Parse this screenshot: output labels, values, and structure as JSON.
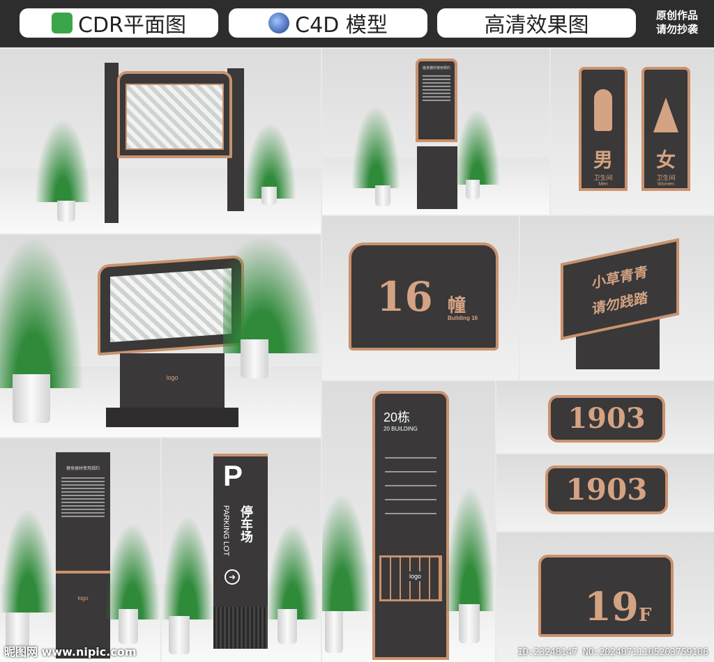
{
  "header": {
    "pill1": "CDR平面图",
    "pill2": "C4D 模型",
    "pill3": "高清效果图",
    "note_line1": "原创作品",
    "note_line2": "请勿抄袭"
  },
  "signs": {
    "male_char": "男",
    "male_sub": "卫生间",
    "male_en": "Men",
    "female_char": "女",
    "female_sub": "卫生间",
    "female_en": "Women",
    "building_num": "16",
    "building_char": "幢",
    "building_en": "Building 16",
    "grass_line1": "小草青青",
    "grass_line2": "请勿践踏",
    "parking_p": "P",
    "parking_cn": "停车场",
    "parking_en": "PARKING LOT",
    "tower_title": "20栋",
    "tower_en": "20 BUILDING",
    "room1": "1903",
    "room2": "1903",
    "floor_num": "19",
    "floor_f": "F",
    "notice_title": "健身器材使用规约",
    "logo": "logo"
  },
  "footer": {
    "site": "昵图网 www.nipic.com",
    "id": "ID:23248147 NO:20240711105203759106"
  },
  "colors": {
    "copper": "#c9926e",
    "dark": "#3a3838",
    "leaf": "#2f8a3a"
  }
}
